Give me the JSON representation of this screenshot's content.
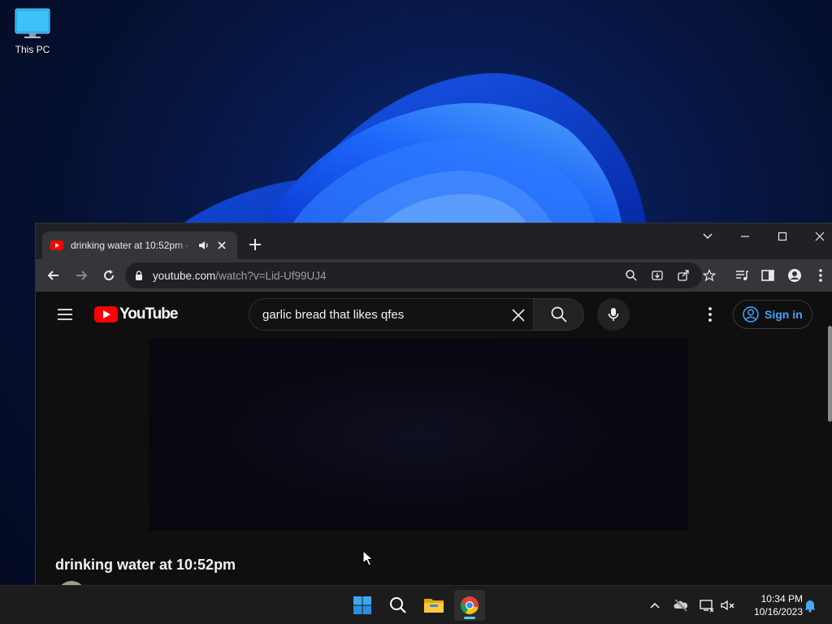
{
  "desktop": {
    "icons": [
      {
        "label": "This PC",
        "icon": "monitor-icon"
      }
    ]
  },
  "browser": {
    "tab": {
      "title": "drinking water at 10:52pm - YouTube",
      "favicon": "youtube-favicon",
      "audio": "speaker-icon"
    },
    "address": {
      "host": "youtube.com",
      "path": "/watch?v=Lid-Uf99UJ4"
    }
  },
  "youtube": {
    "logo_text": "YouTube",
    "search_value": "garlic bread that likes qfes",
    "sign_in": "Sign in",
    "video_title": "drinking water at 10:52pm",
    "accent": "#3ea6ff",
    "brand": "#ff0000"
  },
  "taskbar": {
    "apps": [
      "start-icon",
      "search-icon",
      "file-explorer-icon",
      "chrome-icon"
    ],
    "clock": {
      "time": "10:34 PM",
      "date": "10/16/2023"
    }
  }
}
